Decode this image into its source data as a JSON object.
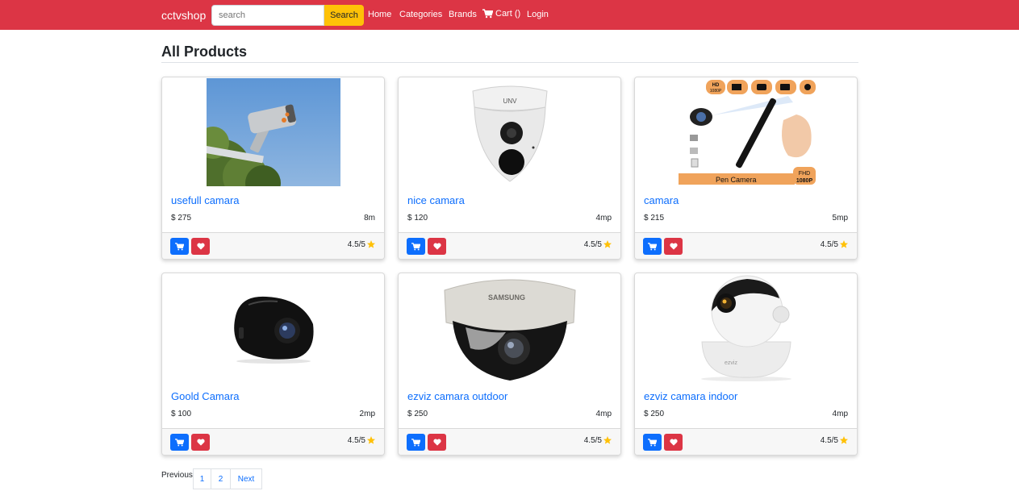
{
  "nav": {
    "brand": "cctvshop",
    "search_placeholder": "search",
    "search_button": "Search",
    "links": {
      "home": "Home",
      "categories": "Categories",
      "brands": "Brands",
      "cart": "Cart ()",
      "login": "Login"
    },
    "bg_color": "#dc3545"
  },
  "page": {
    "title": "All Products"
  },
  "products": [
    {
      "name": "usefull camara",
      "price": "$ 275",
      "spec": "8m",
      "rating": "4.5/5"
    },
    {
      "name": "nice camara",
      "price": "$ 120",
      "spec": "4mp",
      "rating": "4.5/5"
    },
    {
      "name": "camara",
      "price": "$ 215",
      "spec": "5mp",
      "rating": "4.5/5"
    },
    {
      "name": "Goold Camara",
      "price": "$ 100",
      "spec": "2mp",
      "rating": "4.5/5"
    },
    {
      "name": "ezviz camara outdoor",
      "price": "$ 250",
      "spec": "4mp",
      "rating": "4.5/5"
    },
    {
      "name": "ezviz camara indoor",
      "price": "$ 250",
      "spec": "4mp",
      "rating": "4.5/5"
    }
  ],
  "product_images": {
    "pen_camera": {
      "caption_left": "Pen Camera",
      "caption_right_top": "FHD",
      "caption_right_bottom": "1080P",
      "hd_badge_top": "HD",
      "hd_badge_bottom": "1080P"
    },
    "samsung_label": "SAMSUNG",
    "unv_label": "UNV",
    "ezviz_label": "ezviz"
  },
  "pagination": {
    "previous": "Previous",
    "pages": [
      "1",
      "2"
    ],
    "next": "Next"
  }
}
